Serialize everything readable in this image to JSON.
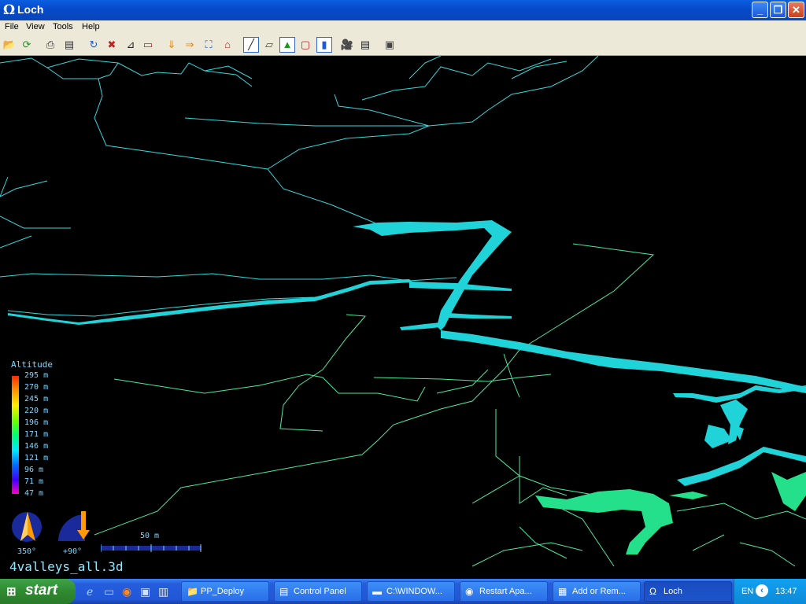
{
  "window": {
    "title": "Loch",
    "icon": "omega-icon",
    "minimize": "_",
    "maximize": "❐",
    "close": "✕"
  },
  "menu": {
    "items": [
      "File",
      "View",
      "Tools",
      "Help"
    ]
  },
  "toolbar": {
    "icons": [
      "open-folder-icon",
      "reload-icon",
      "print-icon",
      "print-setup-icon",
      "rotate-icon",
      "rotate-stop-icon",
      "plan-view-icon",
      "stereo-icon",
      "down-view-icon",
      "east-view-icon",
      "fit-view-icon",
      "home-view-icon",
      "centerline-icon",
      "walls-icon",
      "surface-icon",
      "box-icon",
      "color-scale-icon",
      "walkthrough-icon",
      "details-icon",
      "fullscreen-icon"
    ]
  },
  "legend": {
    "title": "Altitude",
    "labels": [
      "295 m",
      "270 m",
      "245 m",
      "220 m",
      "196 m",
      "171 m",
      "146 m",
      "121 m",
      "96 m",
      "71 m",
      "47 m"
    ]
  },
  "compass": {
    "heading": "350°",
    "tilt": "+90°"
  },
  "scalebar": {
    "label": "50 m"
  },
  "file": {
    "name": "4valleys_all.3d"
  },
  "colors": {
    "centerline": "#34d8e0",
    "centerline_green": "#4be8a0",
    "walls": "#1fd3d8",
    "walls_green": "#24e08a"
  },
  "taskbar": {
    "start": "start",
    "tasks": [
      {
        "label": "PP_Deploy",
        "icon": "folder-icon"
      },
      {
        "label": "Control Panel",
        "icon": "control-panel-icon"
      },
      {
        "label": "C:\\WINDOW...",
        "icon": "console-icon"
      },
      {
        "label": "Restart Apa...",
        "icon": "firefox-icon"
      },
      {
        "label": "Add or Rem...",
        "icon": "add-remove-icon"
      },
      {
        "label": "Loch",
        "icon": "omega-icon"
      }
    ],
    "tray": {
      "lang": "EN",
      "clock": "13:47"
    }
  }
}
